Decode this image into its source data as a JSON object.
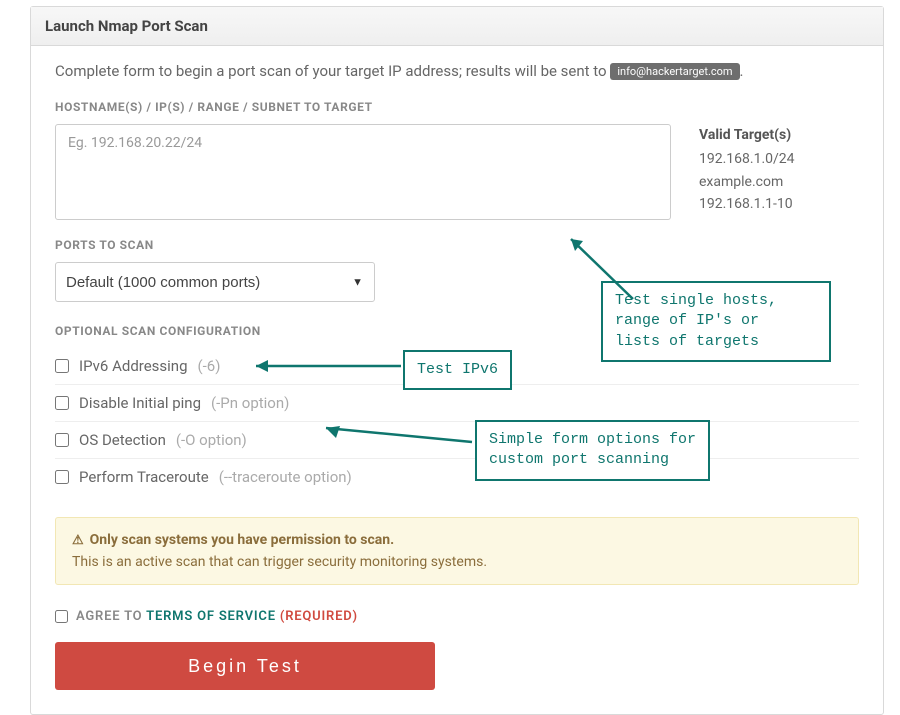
{
  "panel": {
    "title": "Launch Nmap Port Scan"
  },
  "intro": {
    "text": "Complete form to begin a port scan of your target IP address; results will be sent to ",
    "email_badge": "info@hackertarget.com",
    "period": "."
  },
  "hosts": {
    "label": "HOSTNAME(S) / IP(S) / RANGE / SUBNET TO TARGET",
    "placeholder": "Eg. 192.168.20.22/24"
  },
  "valid": {
    "title": "Valid Target(s)",
    "items": [
      "192.168.1.0/24",
      "example.com",
      "192.168.1.1-10"
    ]
  },
  "ports": {
    "label": "PORTS TO SCAN",
    "selected": "Default (1000 common ports)"
  },
  "optional": {
    "label": "OPTIONAL SCAN CONFIGURATION",
    "items": [
      {
        "text": "IPv6 Addressing",
        "hint": "(-6)"
      },
      {
        "text": "Disable Initial ping",
        "hint": "(-Pn option)"
      },
      {
        "text": "OS Detection",
        "hint": "(-O option)"
      },
      {
        "text": "Perform Traceroute",
        "hint": "(--traceroute option)"
      }
    ]
  },
  "warning": {
    "title": "Only scan systems you have permission to scan.",
    "body": "This is an active scan that can trigger security monitoring systems."
  },
  "agree": {
    "pre": "AGREE TO ",
    "tos": "TERMS OF SERVICE",
    "req": " (REQUIRED)"
  },
  "submit": {
    "label": "Begin Test"
  },
  "callouts": {
    "targets": "Test single hosts,\nrange of IP's or\nlists of targets",
    "ipv6": "Test IPv6",
    "custom": "Simple form options for\ncustom port scanning"
  }
}
